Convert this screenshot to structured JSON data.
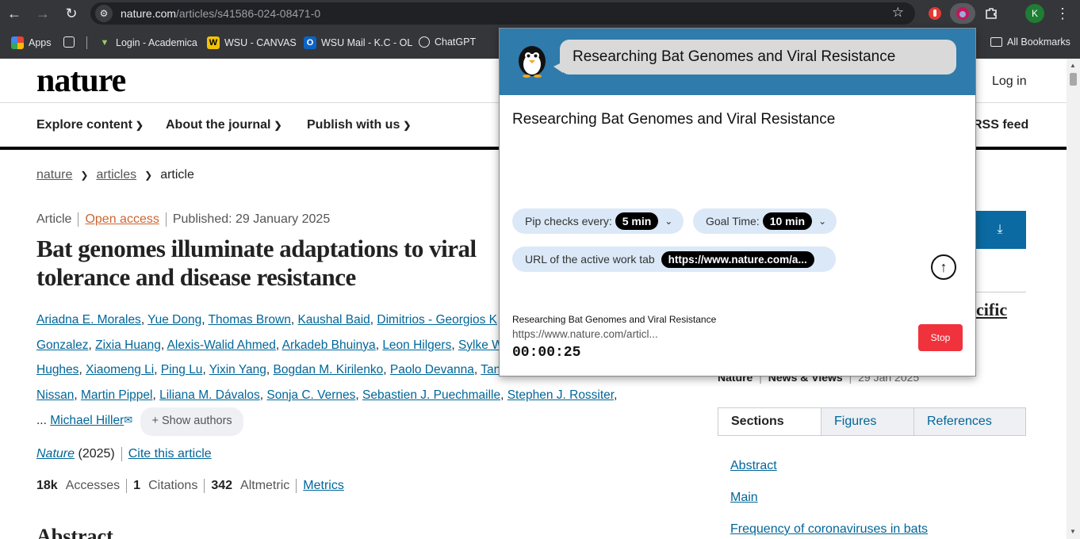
{
  "browser": {
    "url_domain": "nature.com",
    "url_path": "/articles/s41586-024-08471-0",
    "profile_initial": "K",
    "bookmarks": [
      {
        "label": "Apps"
      },
      {
        "label": "Login - Academica"
      },
      {
        "label": "WSU - CANVAS"
      },
      {
        "label": "WSU Mail - K.C - OL"
      },
      {
        "label": "ChatGPT"
      }
    ],
    "all_bookmarks": "All Bookmarks"
  },
  "site": {
    "logo": "nature",
    "login": "Log in",
    "nav": [
      {
        "label": "Explore content"
      },
      {
        "label": "About the journal"
      },
      {
        "label": "Publish with us"
      }
    ],
    "rss": "RSS feed"
  },
  "breadcrumb": {
    "c1": "nature",
    "c2": "articles",
    "c3": "article"
  },
  "article": {
    "type": "Article",
    "access": "Open access",
    "published": "Published: 29 January 2025",
    "title": "Bat genomes illuminate adaptations to viral tolerance and disease resistance",
    "authors_row1": [
      "Ariadna E. Morales",
      "Yue Dong",
      "Thomas Brown",
      "Kaushal Baid",
      "Dimitrios - Georgios K"
    ],
    "authors_row2": [
      "Gonzalez",
      "Zixia Huang",
      "Alexis-Walid Ahmed",
      "Arkadeb Bhuinya",
      "Leon Hilgers",
      "Sylke W"
    ],
    "authors_row3": [
      "Hughes",
      "Xiaomeng Li",
      "Ping Lu",
      "Yixin Yang",
      "Bogdan M. Kirilenko",
      "Paolo Devanna",
      "Tan"
    ],
    "authors_row4": [
      "Nissan",
      "Martin Pippel",
      "Liliana M. Dávalos",
      "Sonja C. Vernes",
      "Sebastien J. Puechmaille",
      "Stephen J. Rossiter"
    ],
    "ellipsis": "...",
    "last_author": "Michael Hiller",
    "show_authors": "Show authors",
    "journal": "Nature",
    "year": "(2025)",
    "cite": "Cite this article",
    "accesses_n": "18k",
    "accesses_l": "Accesses",
    "citations_n": "1",
    "citations_l": "Citations",
    "altmetric_n": "342",
    "altmetric_l": "Altmetric",
    "metrics": "Metrics",
    "abstract_heading": "Abstract"
  },
  "sidebar": {
    "related_fragment": "cific",
    "nv_journal": "Nature",
    "nv_type": "News & Views",
    "nv_date": "29 Jan 2025",
    "tabs": [
      {
        "label": "Sections"
      },
      {
        "label": "Figures"
      },
      {
        "label": "References"
      }
    ],
    "sections": [
      {
        "label": "Abstract"
      },
      {
        "label": "Main"
      },
      {
        "label": "Frequency of coronaviruses in bats"
      }
    ]
  },
  "popup": {
    "bubble": "Researching Bat Genomes and Viral Resistance",
    "title": "Researching Bat Genomes and Viral Resistance",
    "pip_label": "Pip checks every:",
    "pip_value": "5 min",
    "goal_label": "Goal Time:",
    "goal_value": "10 min",
    "url_label": "URL of the active work tab",
    "url_value": "https://www.nature.com/a...",
    "session_title": "Researching Bat Genomes and Viral Resistance",
    "session_url": "https://www.nature.com/articl...",
    "timer": "00:00:25",
    "stop": "Stop"
  },
  "colors": {
    "accent": "#2f7bab",
    "stop": "#f0323c",
    "link": "#006699"
  }
}
